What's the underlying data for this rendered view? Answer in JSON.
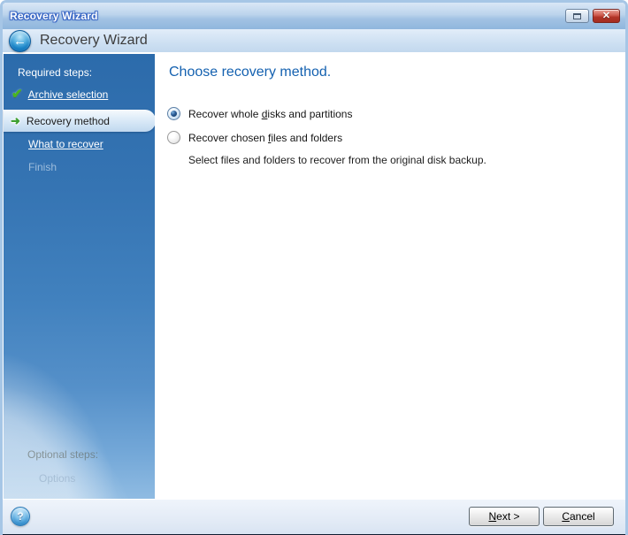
{
  "window": {
    "title": "Recovery Wizard"
  },
  "header": {
    "title": "Recovery Wizard"
  },
  "icons": {
    "back": "←",
    "check": "✔",
    "current_arrow": "➜",
    "close": "✕",
    "help": "?"
  },
  "sidebar": {
    "section_label": "Required steps:",
    "steps": [
      {
        "label": "Archive selection",
        "state": "completed"
      },
      {
        "label": "Recovery method",
        "state": "current"
      },
      {
        "label": "What to recover",
        "state": "upcoming-link"
      },
      {
        "label": "Finish",
        "state": "disabled"
      }
    ],
    "optional_section_label": "Optional steps:",
    "optional_steps": [
      {
        "label": "Options",
        "state": "disabled"
      }
    ]
  },
  "main": {
    "heading": "Choose recovery method.",
    "options": [
      {
        "prefix": "Recover whole ",
        "mnemonic": "d",
        "suffix": "isks and partitions",
        "selected": true
      },
      {
        "prefix": "Recover chosen ",
        "mnemonic": "f",
        "suffix": "iles and folders",
        "selected": false
      }
    ],
    "description": "Select files and folders to recover from the original disk backup."
  },
  "footer": {
    "next_button": {
      "prefix": "",
      "mnemonic": "N",
      "suffix": "ext >"
    },
    "cancel_button": {
      "prefix": "",
      "mnemonic": "C",
      "suffix": "ancel"
    }
  },
  "colors": {
    "accent_heading_blue": "#1461b0",
    "sidebar_blue": "#3574b3",
    "titlebar_blue": "#a3c3e4",
    "check_green": "#49b61f",
    "arrow_green": "#3ea032",
    "close_red": "#b03327",
    "bottom_strip_navy": "#101c30"
  }
}
